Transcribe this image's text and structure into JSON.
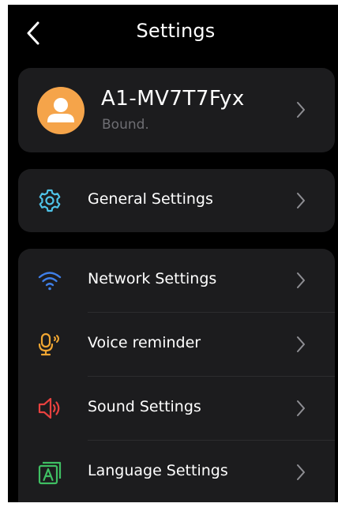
{
  "header": {
    "title": "Settings",
    "back_icon": "chevron-left-icon"
  },
  "profile": {
    "device_name": "A1-MV7T7Fyx",
    "status": "Bound.",
    "avatar_icon": "user-avatar-icon",
    "avatar_color": "#f5a44a"
  },
  "general": {
    "label": "General Settings",
    "icon": "gear-icon",
    "icon_color": "#4fc3e8"
  },
  "menu": [
    {
      "label": "Network Settings",
      "icon": "wifi-icon",
      "icon_color": "#3f7fe8"
    },
    {
      "label": "Voice reminder",
      "icon": "microphone-icon",
      "icon_color": "#f0a632"
    },
    {
      "label": "Sound Settings",
      "icon": "speaker-icon",
      "icon_color": "#e8413f"
    },
    {
      "label": "Language Settings",
      "icon": "language-icon",
      "icon_color": "#3fbf63"
    }
  ],
  "colors": {
    "background": "#000000",
    "card": "#1c1c1e",
    "chevron": "#8e8e93"
  }
}
